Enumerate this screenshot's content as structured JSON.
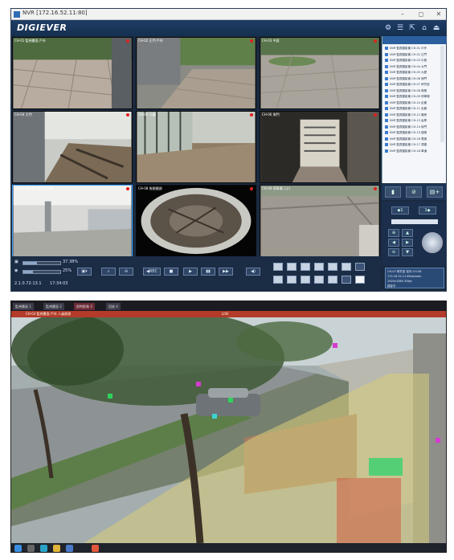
{
  "nvr": {
    "window_title": "NVR [172.16.52.11:80]",
    "window_controls": [
      "–",
      "◻",
      "✕"
    ],
    "logo": "DIGIEVER",
    "header_icons": [
      "gear-icon",
      "list-icon",
      "export-icon",
      "user-icon",
      "logout-icon"
    ],
    "cameras": [
      {
        "label": "CH-01 監視畫面 戶外",
        "scene": "courtyard"
      },
      {
        "label": "CH-02 正門 戶外",
        "scene": "entrance"
      },
      {
        "label": "CH-03 中庭",
        "scene": "plaza"
      },
      {
        "label": "CH-04 大門",
        "scene": "lobby"
      },
      {
        "label": "CH-05 大廳",
        "scene": "hall"
      },
      {
        "label": "CH-06 側門",
        "scene": "corridor"
      },
      {
        "label": "CH-07 研究室 室內 CH-08",
        "scene": "lab"
      },
      {
        "label": "CH-08 魚眼鏡頭",
        "scene": "fisheye"
      },
      {
        "label": "CH-09 停車場 入口",
        "scene": "parking"
      }
    ],
    "device_list": [
      "NVR 監視攝影機 CH-01 戶外",
      "NVR 監視攝影機 CH-02 正門",
      "NVR 監視攝影機 CH-03 中庭",
      "NVR 監視攝影機 CH-04 大門",
      "NVR 監視攝影機 CH-05 大廳",
      "NVR 監視攝影機 CH-06 側門",
      "NVR 監視攝影機 CH-07 研究室",
      "NVR 監視攝影機 CH-08 魚眼",
      "NVR 監視攝影機 CH-09 停車場",
      "NVR 監視攝影機 CH-10 走廊",
      "NVR 監視攝影機 CH-11 走廊",
      "NVR 監視攝影機 CH-12 機房",
      "NVR 監視攝影機 CH-13 倉庫",
      "NVR 監視攝影機 CH-14 後門",
      "NVR 監視攝影機 CH-15 樓梯",
      "NVR 監視攝影機 CH-16 電梯",
      "NVR 監視攝影機 CH-17 頂樓",
      "NVR 監視攝影機 CH-18 車道"
    ],
    "side_buttons": [
      "▮",
      "⊘",
      "▤+"
    ],
    "ptz_buttons": [
      "◆1",
      "1◆",
      "▲",
      "◀",
      "▶",
      "▼",
      "⊕",
      "⊖"
    ],
    "cpu_percent": 37.38,
    "cpu_text": "37.38%",
    "ram_percent": 25,
    "ram_text": "25%",
    "version": "2.1.0.72-13.1",
    "time": "17:34:03",
    "info_lines": [
      "CH-07 研究室 室內 CH-08",
      "172.16.52.11:80/stream",
      "1920x1080 30fps",
      "錄影中"
    ],
    "control_buttons": [
      "▣▾",
      "⌕",
      "⊖",
      "◀REC",
      "■",
      "▶",
      "▮▮",
      "▶▶",
      "◀)"
    ]
  },
  "live": {
    "tabs": [
      "監視畫面 1",
      "監視畫面 2",
      "即時影像 3",
      "回放 4"
    ],
    "red_bar_left": "CH-03 監視畫面 戶外 人員偵測",
    "red_bar_center": "LIVE",
    "taskbar_icons": [
      "windows-icon",
      "search-icon",
      "edge-icon",
      "folder-icon",
      "mail-icon",
      "app-icon"
    ]
  },
  "colors": {
    "accent": "#2c5f9e",
    "record": "#e02020",
    "detection_zone": "#d98a6a"
  }
}
